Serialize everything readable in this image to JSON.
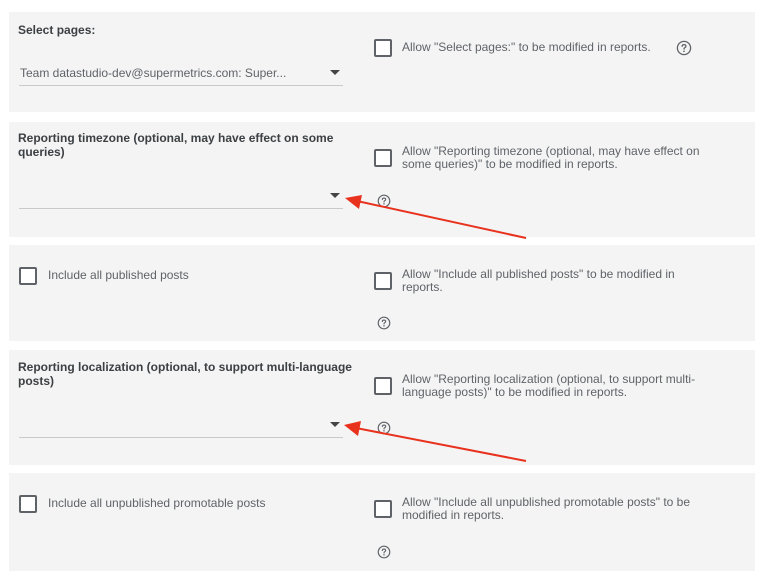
{
  "sections": {
    "select_pages": {
      "label": "Select pages:",
      "value": "Team datastudio-dev@supermetrics.com: Super...",
      "allow_text": "Allow \"Select pages:\" to be modified in reports."
    },
    "timezone": {
      "label": "Reporting timezone (optional, may have effect on some queries)",
      "value": "",
      "allow_text": "Allow \"Reporting timezone (optional, may have effect on some queries)\" to be modified in reports."
    },
    "published_posts": {
      "label": "Include all published posts",
      "allow_text": "Allow \"Include all published posts\" to be modified in reports."
    },
    "localization": {
      "label": "Reporting localization (optional, to support multi-language posts)",
      "value": "",
      "allow_text": "Allow \"Reporting localization (optional, to support multi-language posts)\" to be modified in reports."
    },
    "unpublished_posts": {
      "label": "Include all unpublished promotable posts",
      "allow_text": "Allow \"Include all unpublished promotable posts\" to be modified in reports."
    }
  },
  "colors": {
    "panel_bg": "#f4f4f4",
    "annotation_arrow": "#e8321e"
  },
  "icons": {
    "help": "help-circle-icon",
    "dropdown": "triangle-down-icon"
  }
}
